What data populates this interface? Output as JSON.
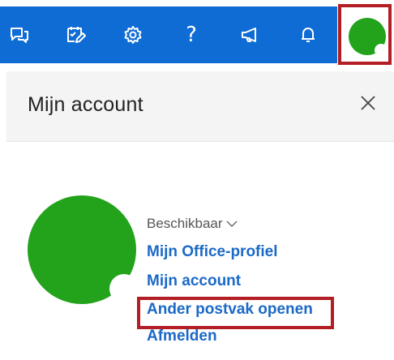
{
  "topbar": {
    "icons": [
      "chat-icon",
      "tasks-icon",
      "gear-icon",
      "help-icon",
      "megaphone-icon",
      "bell-icon"
    ],
    "help_glyph": "?",
    "accent_color": "#0f6cd5",
    "avatar_color": "#22a31b",
    "highlight_color": "#b21e24"
  },
  "panel": {
    "title": "Mijn account",
    "status_label": "Beschikbaar",
    "links": {
      "office_profile": "Mijn Office-profiel",
      "my_account": "Mijn account",
      "open_other_mailbox": "Ander postvak openen",
      "sign_out": "Afmelden"
    }
  }
}
